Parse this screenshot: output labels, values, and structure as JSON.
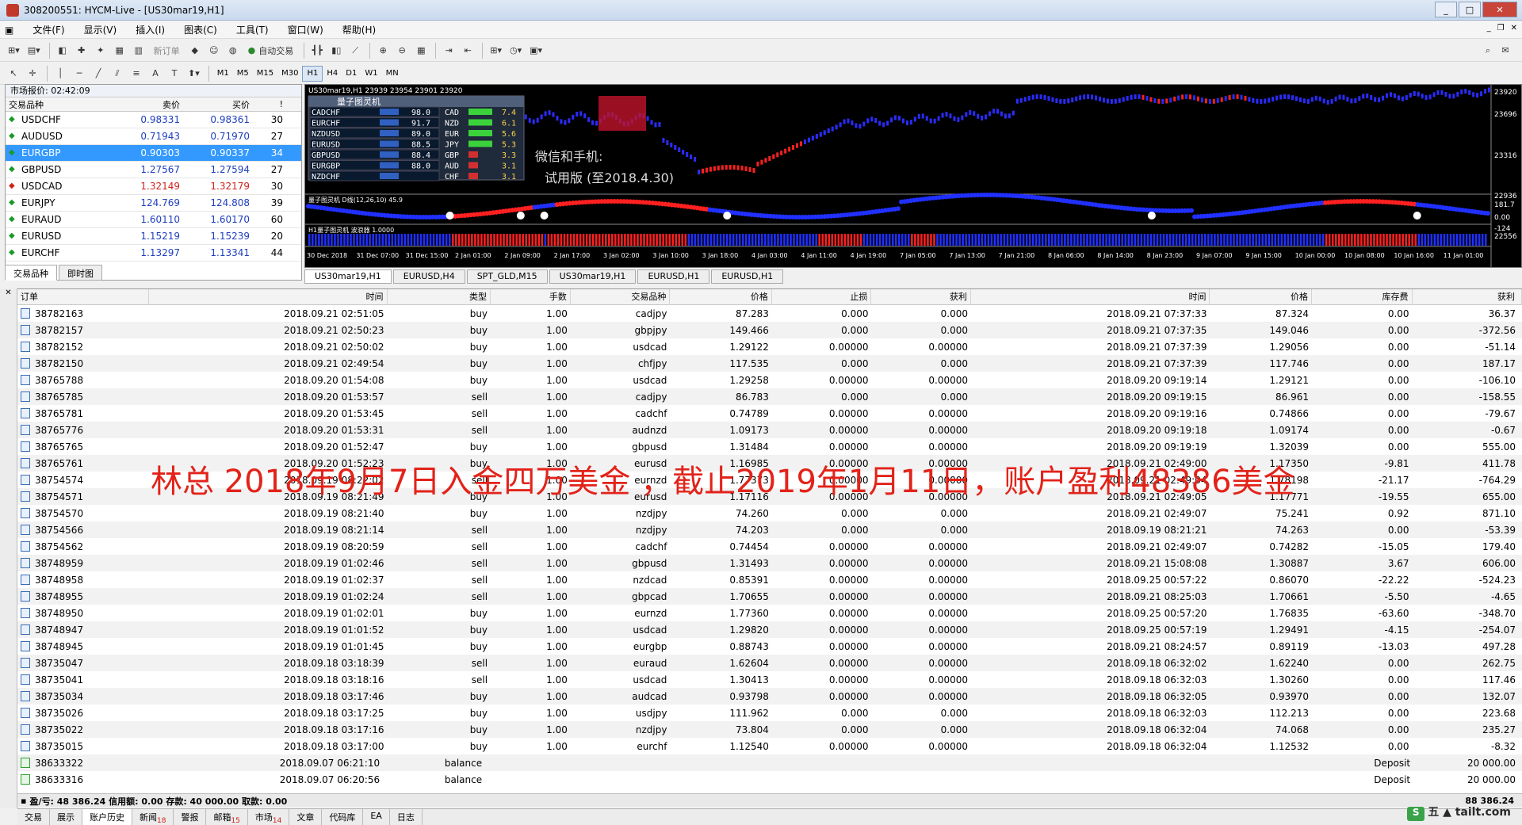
{
  "window": {
    "title": "308200551: HYCM-Live - [US30mar19,H1]"
  },
  "menu": [
    "文件(F)",
    "显示(V)",
    "插入(I)",
    "图表(C)",
    "工具(T)",
    "窗口(W)",
    "帮助(H)"
  ],
  "toolbar": {
    "new_order": "新订单",
    "auto_trade": "自动交易"
  },
  "timeframes": [
    "M1",
    "M5",
    "M15",
    "M30",
    "H1",
    "H4",
    "D1",
    "W1",
    "MN"
  ],
  "market_watch": {
    "title": "市场报价: 02:42:09",
    "headers": {
      "symbol": "交易品种",
      "bid": "卖价",
      "ask": "买价",
      "spread": "!"
    },
    "rows": [
      {
        "sym": "USDCHF",
        "bid": "0.98331",
        "ask": "0.98361",
        "spr": "30",
        "dir": "up"
      },
      {
        "sym": "AUDUSD",
        "bid": "0.71943",
        "ask": "0.71970",
        "spr": "27",
        "dir": "up"
      },
      {
        "sym": "EURGBP",
        "bid": "0.90303",
        "ask": "0.90337",
        "spr": "34",
        "dir": "up",
        "sel": true
      },
      {
        "sym": "GBPUSD",
        "bid": "1.27567",
        "ask": "1.27594",
        "spr": "27",
        "dir": "up"
      },
      {
        "sym": "USDCAD",
        "bid": "1.32149",
        "ask": "1.32179",
        "spr": "30",
        "dir": "dn"
      },
      {
        "sym": "EURJPY",
        "bid": "124.769",
        "ask": "124.808",
        "spr": "39",
        "dir": "up"
      },
      {
        "sym": "EURAUD",
        "bid": "1.60110",
        "ask": "1.60170",
        "spr": "60",
        "dir": "up"
      },
      {
        "sym": "EURUSD",
        "bid": "1.15219",
        "ask": "1.15239",
        "spr": "20",
        "dir": "up"
      },
      {
        "sym": "EURCHF",
        "bid": "1.13297",
        "ask": "1.13341",
        "spr": "44",
        "dir": "up"
      }
    ],
    "tabs": [
      "交易品种",
      "即时图"
    ]
  },
  "chart": {
    "header": "US30mar19,H1  23939 23954 23901 23920",
    "panel_title": "量子图灵机",
    "panel_rows": [
      {
        "pair": "CADCHF",
        "val": "98.0",
        "cur": "CAD",
        "score": "7.4"
      },
      {
        "pair": "EURCHF",
        "val": "91.7",
        "cur": "NZD",
        "score": "6.1"
      },
      {
        "pair": "NZDUSD",
        "val": "89.0",
        "cur": "EUR",
        "score": "5.6"
      },
      {
        "pair": "EURUSD",
        "val": "88.5",
        "cur": "JPY",
        "score": "5.3"
      },
      {
        "pair": "GBPUSD",
        "val": "88.4",
        "cur": "GBP",
        "score": "3.3"
      },
      {
        "pair": "EURGBP",
        "val": "88.0",
        "cur": "AUD",
        "score": "3.1"
      },
      {
        "pair": "NZDCHF",
        "val": "",
        "cur": "CHF",
        "score": "3.1"
      }
    ],
    "promo1": "微信和手机:",
    "promo2": "试用版 (至2018.4.30)",
    "price_labels": [
      "23920",
      "23696",
      "23316",
      "22936",
      "22556"
    ],
    "osc_label": "量子图灵机 D线(12,26,10) 45.9",
    "osc_levels": [
      "181.7",
      "0.00",
      "-124"
    ],
    "hist_label": "H1量子图灵机 波浪器 1.0000",
    "time_labels": [
      "30 Dec 2018",
      "31 Dec 07:00",
      "31 Dec 15:00",
      "2 Jan 01:00",
      "2 Jan 09:00",
      "2 Jan 17:00",
      "3 Jan 02:00",
      "3 Jan 10:00",
      "3 Jan 18:00",
      "4 Jan 03:00",
      "4 Jan 11:00",
      "4 Jan 19:00",
      "7 Jan 05:00",
      "7 Jan 13:00",
      "7 Jan 21:00",
      "8 Jan 06:00",
      "8 Jan 14:00",
      "8 Jan 23:00",
      "9 Jan 07:00",
      "9 Jan 15:00",
      "10 Jan 00:00",
      "10 Jan 08:00",
      "10 Jan 16:00",
      "11 Jan 01:00"
    ],
    "tabs": [
      "US30mar19,H1",
      "EURUSD,H4",
      "SPT_GLD,M15",
      "US30mar19,H1",
      "EURUSD,H1",
      "EURUSD,H1"
    ]
  },
  "history": {
    "headers": [
      "订单",
      "时间",
      "类型",
      "手数",
      "交易品种",
      "价格",
      "止损",
      "获利",
      "时间",
      "价格",
      "库存费",
      "获利"
    ],
    "rows": [
      [
        "38782163",
        "2018.09.21 02:51:05",
        "buy",
        "1.00",
        "cadjpy",
        "87.283",
        "0.000",
        "0.000",
        "2018.09.21 07:37:33",
        "87.324",
        "0.00",
        "36.37"
      ],
      [
        "38782157",
        "2018.09.21 02:50:23",
        "buy",
        "1.00",
        "gbpjpy",
        "149.466",
        "0.000",
        "0.000",
        "2018.09.21 07:37:35",
        "149.046",
        "0.00",
        "-372.56"
      ],
      [
        "38782152",
        "2018.09.21 02:50:02",
        "buy",
        "1.00",
        "usdcad",
        "1.29122",
        "0.00000",
        "0.00000",
        "2018.09.21 07:37:39",
        "1.29056",
        "0.00",
        "-51.14"
      ],
      [
        "38782150",
        "2018.09.21 02:49:54",
        "buy",
        "1.00",
        "chfjpy",
        "117.535",
        "0.000",
        "0.000",
        "2018.09.21 07:37:39",
        "117.746",
        "0.00",
        "187.17"
      ],
      [
        "38765788",
        "2018.09.20 01:54:08",
        "buy",
        "1.00",
        "usdcad",
        "1.29258",
        "0.00000",
        "0.00000",
        "2018.09.20 09:19:14",
        "1.29121",
        "0.00",
        "-106.10"
      ],
      [
        "38765785",
        "2018.09.20 01:53:57",
        "sell",
        "1.00",
        "cadjpy",
        "86.783",
        "0.000",
        "0.000",
        "2018.09.20 09:19:15",
        "86.961",
        "0.00",
        "-158.55"
      ],
      [
        "38765781",
        "2018.09.20 01:53:45",
        "sell",
        "1.00",
        "cadchf",
        "0.74789",
        "0.00000",
        "0.00000",
        "2018.09.20 09:19:16",
        "0.74866",
        "0.00",
        "-79.67"
      ],
      [
        "38765776",
        "2018.09.20 01:53:31",
        "sell",
        "1.00",
        "audnzd",
        "1.09173",
        "0.00000",
        "0.00000",
        "2018.09.20 09:19:18",
        "1.09174",
        "0.00",
        "-0.67"
      ],
      [
        "38765765",
        "2018.09.20 01:52:47",
        "buy",
        "1.00",
        "gbpusd",
        "1.31484",
        "0.00000",
        "0.00000",
        "2018.09.20 09:19:19",
        "1.32039",
        "0.00",
        "555.00"
      ],
      [
        "38765761",
        "2018.09.20 01:52:23",
        "buy",
        "1.00",
        "eurusd",
        "1.16985",
        "0.00000",
        "0.00000",
        "2018.09.21 02:49:00",
        "1.17350",
        "-9.81",
        "411.78"
      ],
      [
        "38754574",
        "2018.09.19 08:22:02",
        "sell",
        "1.00",
        "eurnzd",
        "1.77373",
        "0.00000",
        "0.00000",
        "2018.09.21 02:49:04",
        "1.78198",
        "-21.17",
        "-764.29"
      ],
      [
        "38754571",
        "2018.09.19 08:21:49",
        "buy",
        "1.00",
        "eurusd",
        "1.17116",
        "0.00000",
        "0.00000",
        "2018.09.21 02:49:05",
        "1.17771",
        "-19.55",
        "655.00"
      ],
      [
        "38754570",
        "2018.09.19 08:21:40",
        "buy",
        "1.00",
        "nzdjpy",
        "74.260",
        "0.000",
        "0.000",
        "2018.09.21 02:49:07",
        "75.241",
        "0.92",
        "871.10"
      ],
      [
        "38754566",
        "2018.09.19 08:21:14",
        "sell",
        "1.00",
        "nzdjpy",
        "74.203",
        "0.000",
        "0.000",
        "2018.09.19 08:21:21",
        "74.263",
        "0.00",
        "-53.39"
      ],
      [
        "38754562",
        "2018.09.19 08:20:59",
        "sell",
        "1.00",
        "cadchf",
        "0.74454",
        "0.00000",
        "0.00000",
        "2018.09.21 02:49:07",
        "0.74282",
        "-15.05",
        "179.40"
      ],
      [
        "38748959",
        "2018.09.19 01:02:46",
        "sell",
        "1.00",
        "gbpusd",
        "1.31493",
        "0.00000",
        "0.00000",
        "2018.09.21 15:08:08",
        "1.30887",
        "3.67",
        "606.00"
      ],
      [
        "38748958",
        "2018.09.19 01:02:37",
        "sell",
        "1.00",
        "nzdcad",
        "0.85391",
        "0.00000",
        "0.00000",
        "2018.09.25 00:57:22",
        "0.86070",
        "-22.22",
        "-524.23"
      ],
      [
        "38748955",
        "2018.09.19 01:02:24",
        "sell",
        "1.00",
        "gbpcad",
        "1.70655",
        "0.00000",
        "0.00000",
        "2018.09.21 08:25:03",
        "1.70661",
        "-5.50",
        "-4.65"
      ],
      [
        "38748950",
        "2018.09.19 01:02:01",
        "buy",
        "1.00",
        "eurnzd",
        "1.77360",
        "0.00000",
        "0.00000",
        "2018.09.25 00:57:20",
        "1.76835",
        "-63.60",
        "-348.70"
      ],
      [
        "38748947",
        "2018.09.19 01:01:52",
        "buy",
        "1.00",
        "usdcad",
        "1.29820",
        "0.00000",
        "0.00000",
        "2018.09.25 00:57:19",
        "1.29491",
        "-4.15",
        "-254.07"
      ],
      [
        "38748945",
        "2018.09.19 01:01:45",
        "buy",
        "1.00",
        "eurgbp",
        "0.88743",
        "0.00000",
        "0.00000",
        "2018.09.21 08:24:57",
        "0.89119",
        "-13.03",
        "497.28"
      ],
      [
        "38735047",
        "2018.09.18 03:18:39",
        "sell",
        "1.00",
        "euraud",
        "1.62604",
        "0.00000",
        "0.00000",
        "2018.09.18 06:32:02",
        "1.62240",
        "0.00",
        "262.75"
      ],
      [
        "38735041",
        "2018.09.18 03:18:16",
        "sell",
        "1.00",
        "usdcad",
        "1.30413",
        "0.00000",
        "0.00000",
        "2018.09.18 06:32:03",
        "1.30260",
        "0.00",
        "117.46"
      ],
      [
        "38735034",
        "2018.09.18 03:17:46",
        "buy",
        "1.00",
        "audcad",
        "0.93798",
        "0.00000",
        "0.00000",
        "2018.09.18 06:32:05",
        "0.93970",
        "0.00",
        "132.07"
      ],
      [
        "38735026",
        "2018.09.18 03:17:25",
        "buy",
        "1.00",
        "usdjpy",
        "111.962",
        "0.000",
        "0.000",
        "2018.09.18 06:32:03",
        "112.213",
        "0.00",
        "223.68"
      ],
      [
        "38735022",
        "2018.09.18 03:17:16",
        "buy",
        "1.00",
        "nzdjpy",
        "73.804",
        "0.000",
        "0.000",
        "2018.09.18 06:32:04",
        "74.068",
        "0.00",
        "235.27"
      ],
      [
        "38735015",
        "2018.09.18 03:17:00",
        "buy",
        "1.00",
        "eurchf",
        "1.12540",
        "0.00000",
        "0.00000",
        "2018.09.18 06:32:04",
        "1.12532",
        "0.00",
        "-8.32"
      ]
    ],
    "balance_rows": [
      {
        "order": "38633322",
        "time": "2018.09.07 06:21:10",
        "type": "balance",
        "note": "Deposit",
        "profit": "20 000.00"
      },
      {
        "order": "38633316",
        "time": "2018.09.07 06:20:56",
        "type": "balance",
        "note": "Deposit",
        "profit": "20 000.00"
      }
    ],
    "summary": "盈/亏: 48 386.24  信用额: 0.00  存款: 40 000.00  取款: 0.00",
    "summary_total": "88 386.24"
  },
  "overlay_text": "林总  2018年9月7日入金四万美金 ，截止2019年1月11日，账户盈利48386美金",
  "bottom_tabs": [
    {
      "label": "交易"
    },
    {
      "label": "展示"
    },
    {
      "label": "账户历史",
      "active": true
    },
    {
      "label": "新闻",
      "badge": "18"
    },
    {
      "label": "警报"
    },
    {
      "label": "邮箱",
      "badge": "15"
    },
    {
      "label": "市场",
      "badge": "14"
    },
    {
      "label": "文章"
    },
    {
      "label": "代码库"
    },
    {
      "label": "EA"
    },
    {
      "label": "日志"
    }
  ],
  "watermark": "五 ▲ tailt.com"
}
